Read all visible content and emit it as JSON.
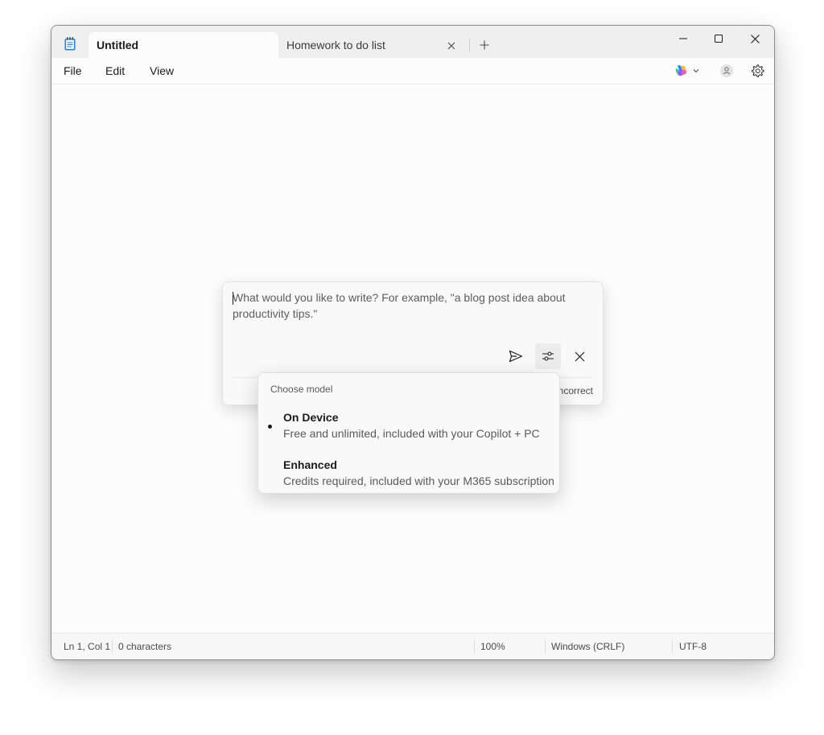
{
  "tabs": [
    {
      "label": "Untitled",
      "active": true
    },
    {
      "label": "Homework to do list",
      "active": false
    }
  ],
  "window_controls": {
    "minimize_icon": "minimize-icon",
    "maximize_icon": "maximize-icon",
    "close_icon": "close-icon"
  },
  "menu": {
    "items": [
      "File",
      "Edit",
      "View"
    ]
  },
  "toolbar_right_icons": [
    "copilot-icon",
    "account-icon",
    "gear-icon"
  ],
  "write_panel": {
    "placeholder": "What would you like to write? For example, \"a blog post idea about productivity tips.\"",
    "behind_text": "ncorrect",
    "buttons": [
      "send-icon",
      "sliders-icon",
      "close-icon"
    ]
  },
  "model_menu": {
    "header": "Choose model",
    "options": [
      {
        "title": "On Device",
        "description": "Free and unlimited, included with your Copilot + PC",
        "selected": true
      },
      {
        "title": "Enhanced",
        "description": "Credits required, included with your M365 subscription",
        "selected": false
      }
    ]
  },
  "status": {
    "position": "Ln 1, Col 1",
    "characters": "0 characters",
    "zoom": "100%",
    "line_endings": "Windows (CRLF)",
    "encoding": "UTF-8"
  },
  "colors": {
    "titlebar": "#efefef",
    "window": "#fcfcfc",
    "accent_copilot": "#7a5cf0"
  }
}
